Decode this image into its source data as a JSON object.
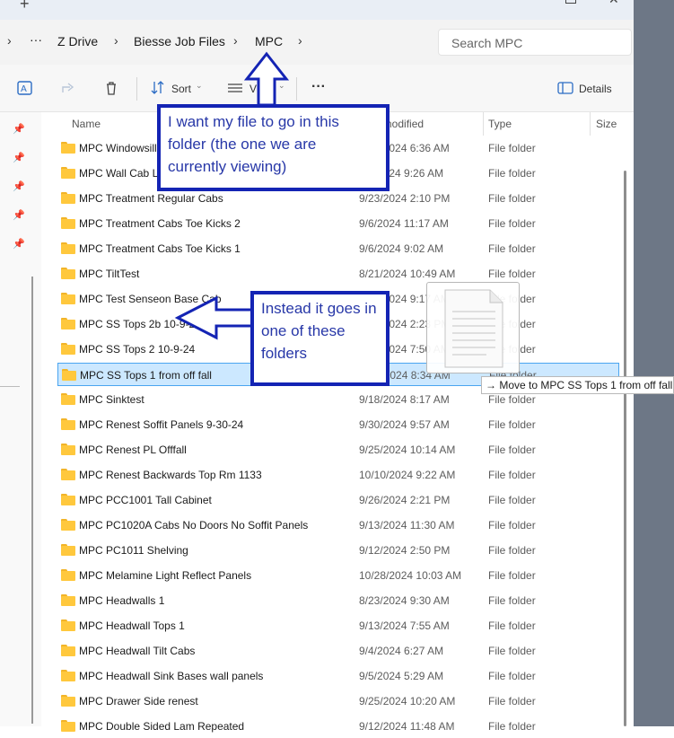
{
  "titlebar": {
    "new_tab_glyph": "+",
    "close_glyph": "✕"
  },
  "address": {
    "overflow_glyph": "···",
    "crumbs": [
      "Z Drive",
      "Biesse Job Files",
      "MPC"
    ],
    "separator": "›"
  },
  "search": {
    "placeholder": "Search MPC"
  },
  "toolbar": {
    "sort_label": "Sort",
    "view_label": "View",
    "more_glyph": "···",
    "details_label": "Details"
  },
  "columns": {
    "name": "Name",
    "date_modified": "Date modified",
    "type": "Type",
    "size": "Size"
  },
  "files": [
    {
      "name": "MPC Windowsill 08-08-2024",
      "date": "8/12/2024 6:36 AM",
      "type": "File folder"
    },
    {
      "name": "MPC Wall Cab Lock Test",
      "date": "9/9/2024 9:26 AM",
      "type": "File folder"
    },
    {
      "name": "MPC Treatment Regular Cabs",
      "date": "9/23/2024 2:10 PM",
      "type": "File folder"
    },
    {
      "name": "MPC Treatment Cabs Toe Kicks 2",
      "date": "9/6/2024 11:17 AM",
      "type": "File folder"
    },
    {
      "name": "MPC Treatment Cabs Toe Kicks 1",
      "date": "9/6/2024 9:02 AM",
      "type": "File folder"
    },
    {
      "name": "MPC TiltTest",
      "date": "8/21/2024 10:49 AM",
      "type": "File folder"
    },
    {
      "name": "MPC Test Senseon Base Cab",
      "date": "9/19/2024 9:17 AM",
      "type": "File folder"
    },
    {
      "name": "MPC SS Tops 2b 10-9-24",
      "date": "10/9/2024 2:23 PM",
      "type": "File folder"
    },
    {
      "name": "MPC SS Tops 2 10-9-24",
      "date": "10/9/2024 7:50 AM",
      "type": "File folder"
    },
    {
      "name": "MPC SS Tops 1 from off fall",
      "date": "9/18/2024 8:34 AM",
      "type": "File folder",
      "selected": true
    },
    {
      "name": "MPC Sinktest",
      "date": "9/18/2024 8:17 AM",
      "type": "File folder"
    },
    {
      "name": "MPC Renest Soffit Panels 9-30-24",
      "date": "9/30/2024 9:57 AM",
      "type": "File folder"
    },
    {
      "name": "MPC Renest PL Offfall",
      "date": "9/25/2024 10:14 AM",
      "type": "File folder"
    },
    {
      "name": "MPC Renest Backwards Top Rm 1133",
      "date": "10/10/2024 9:22 AM",
      "type": "File folder"
    },
    {
      "name": "MPC PCC1001 Tall Cabinet",
      "date": "9/26/2024 2:21 PM",
      "type": "File folder"
    },
    {
      "name": "MPC PC1020A Cabs No Doors No Soffit Panels",
      "date": "9/13/2024 11:30 AM",
      "type": "File folder"
    },
    {
      "name": "MPC PC1011 Shelving",
      "date": "9/12/2024 2:50 PM",
      "type": "File folder"
    },
    {
      "name": "MPC Melamine Light Reflect Panels",
      "date": "10/28/2024 10:03 AM",
      "type": "File folder"
    },
    {
      "name": "MPC Headwalls 1",
      "date": "8/23/2024 9:30 AM",
      "type": "File folder"
    },
    {
      "name": "MPC Headwall Tops 1",
      "date": "9/13/2024 7:55 AM",
      "type": "File folder"
    },
    {
      "name": "MPC Headwall Tilt Cabs",
      "date": "9/4/2024 6:27 AM",
      "type": "File folder"
    },
    {
      "name": "MPC Headwall Sink Bases wall panels",
      "date": "9/5/2024 5:29 AM",
      "type": "File folder"
    },
    {
      "name": "MPC Drawer Side renest",
      "date": "9/25/2024 10:20 AM",
      "type": "File folder"
    },
    {
      "name": "MPC Double Sided Lam Repeated",
      "date": "9/12/2024 11:48 AM",
      "type": "File folder"
    }
  ],
  "callouts": {
    "top": "I want my file to go in this folder (the one we are currently viewing)",
    "middle": "Instead it goes in one of these folders"
  },
  "drag_tooltip": "→ Move to MPC SS Tops 1 from off fall",
  "colors": {
    "annotation": "#1424b4",
    "selection_bg": "#cce8ff",
    "selection_border": "#4aa5f0",
    "folder": "#ffc83d"
  }
}
